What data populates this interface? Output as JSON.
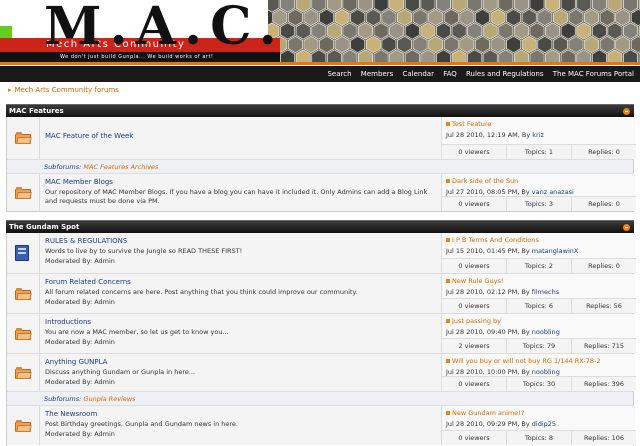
{
  "header": {
    "logo": "M.A.C.",
    "site_name": "Mech Arts Community",
    "tagline": "We don't just build Gunpla... We build works of art!"
  },
  "nav": [
    "Search",
    "Members",
    "Calendar",
    "FAQ",
    "Rules and Regulations",
    "The MAC Forums Portal"
  ],
  "breadcrumb": "Mech Arts Community forums",
  "categories": [
    {
      "title": "MAC Features",
      "forums": [
        {
          "title": "MAC Feature of the Week",
          "last_title": "Test Feature",
          "last_date": "Jul 28 2010, 12:19 AM, By",
          "last_user": "kriz",
          "viewers": "0 viewers",
          "topics": "Topics: 1",
          "replies": "Replies: 0",
          "subforums_label": "Subforums:",
          "subforums": "MAC Features Archives"
        },
        {
          "title": "MAC Member Blogs",
          "desc": "Our repository of MAC Member Blogs. If you have a blog you can have it included it. Only Admins can add a Blog Link and requests must be done via PM.",
          "last_title": "Dark side of the Sun",
          "last_date": "Jul 27 2010, 08:05 PM, By",
          "last_user": "vanz anazasi",
          "viewers": "0 viewers",
          "topics": "Topics: 3",
          "replies": "Replies: 0"
        }
      ]
    },
    {
      "title": "The Gundam Spot",
      "forums": [
        {
          "title": "RULES & REGULATIONS",
          "desc": "Words to live by to survive the Jungle so READ THESE FIRST!",
          "mod": "Moderated By: Admin",
          "last_title": "I P B Terms And Conditions",
          "last_date": "Jul 15 2010, 01:45 PM, By",
          "last_user": "matanglawinX",
          "viewers": "0 viewers",
          "topics": "Topics: 2",
          "replies": "Replies: 0"
        },
        {
          "title": "Forum Related Concerns",
          "desc": "All forum related concerns are here. Post anything that you think could improve our community.",
          "mod": "Moderated By: Admin",
          "last_title": "New Rule Guys!",
          "last_date": "Jul 28 2010, 02:12 PM, By",
          "last_user": "filmechs",
          "viewers": "0 viewers",
          "topics": "Topics: 6",
          "replies": "Replies: 56"
        },
        {
          "title": "Introductions",
          "desc": "You are now a MAC member, so let us get to know you...",
          "mod": "Moderated By: Admin",
          "last_title": "Just passing by",
          "last_date": "Jul 28 2010, 09:40 PM, By",
          "last_user": "noobling",
          "viewers": "2 viewers",
          "topics": "Topics: 79",
          "replies": "Replies: 715"
        },
        {
          "title": "Anything GUNPLA",
          "desc": "Discuss anything Gundam or Gunpla in here...",
          "mod": "Moderated By: Admin",
          "last_title": "Will you buy or will not buy RG 1/144 RX-78-2",
          "last_date": "Jul 28 2010, 10:00 PM, By",
          "last_user": "noobling",
          "viewers": "0 viewers",
          "topics": "Topics: 30",
          "replies": "Replies: 396",
          "subforums_label": "Subforums:",
          "subforums": "Gunpla Reviews"
        },
        {
          "title": "The Newsroom",
          "desc": "Post Birthday greetings, Gunpla and Gundam news in here.",
          "mod": "Moderated By: Admin",
          "last_title": "New Gundam anime!?",
          "last_date": "Jul 28 2010, 09:29 PM, By",
          "last_user": "didip25",
          "viewers": "0 viewers",
          "topics": "Topics: 8",
          "replies": "Replies: 106"
        }
      ]
    }
  ]
}
